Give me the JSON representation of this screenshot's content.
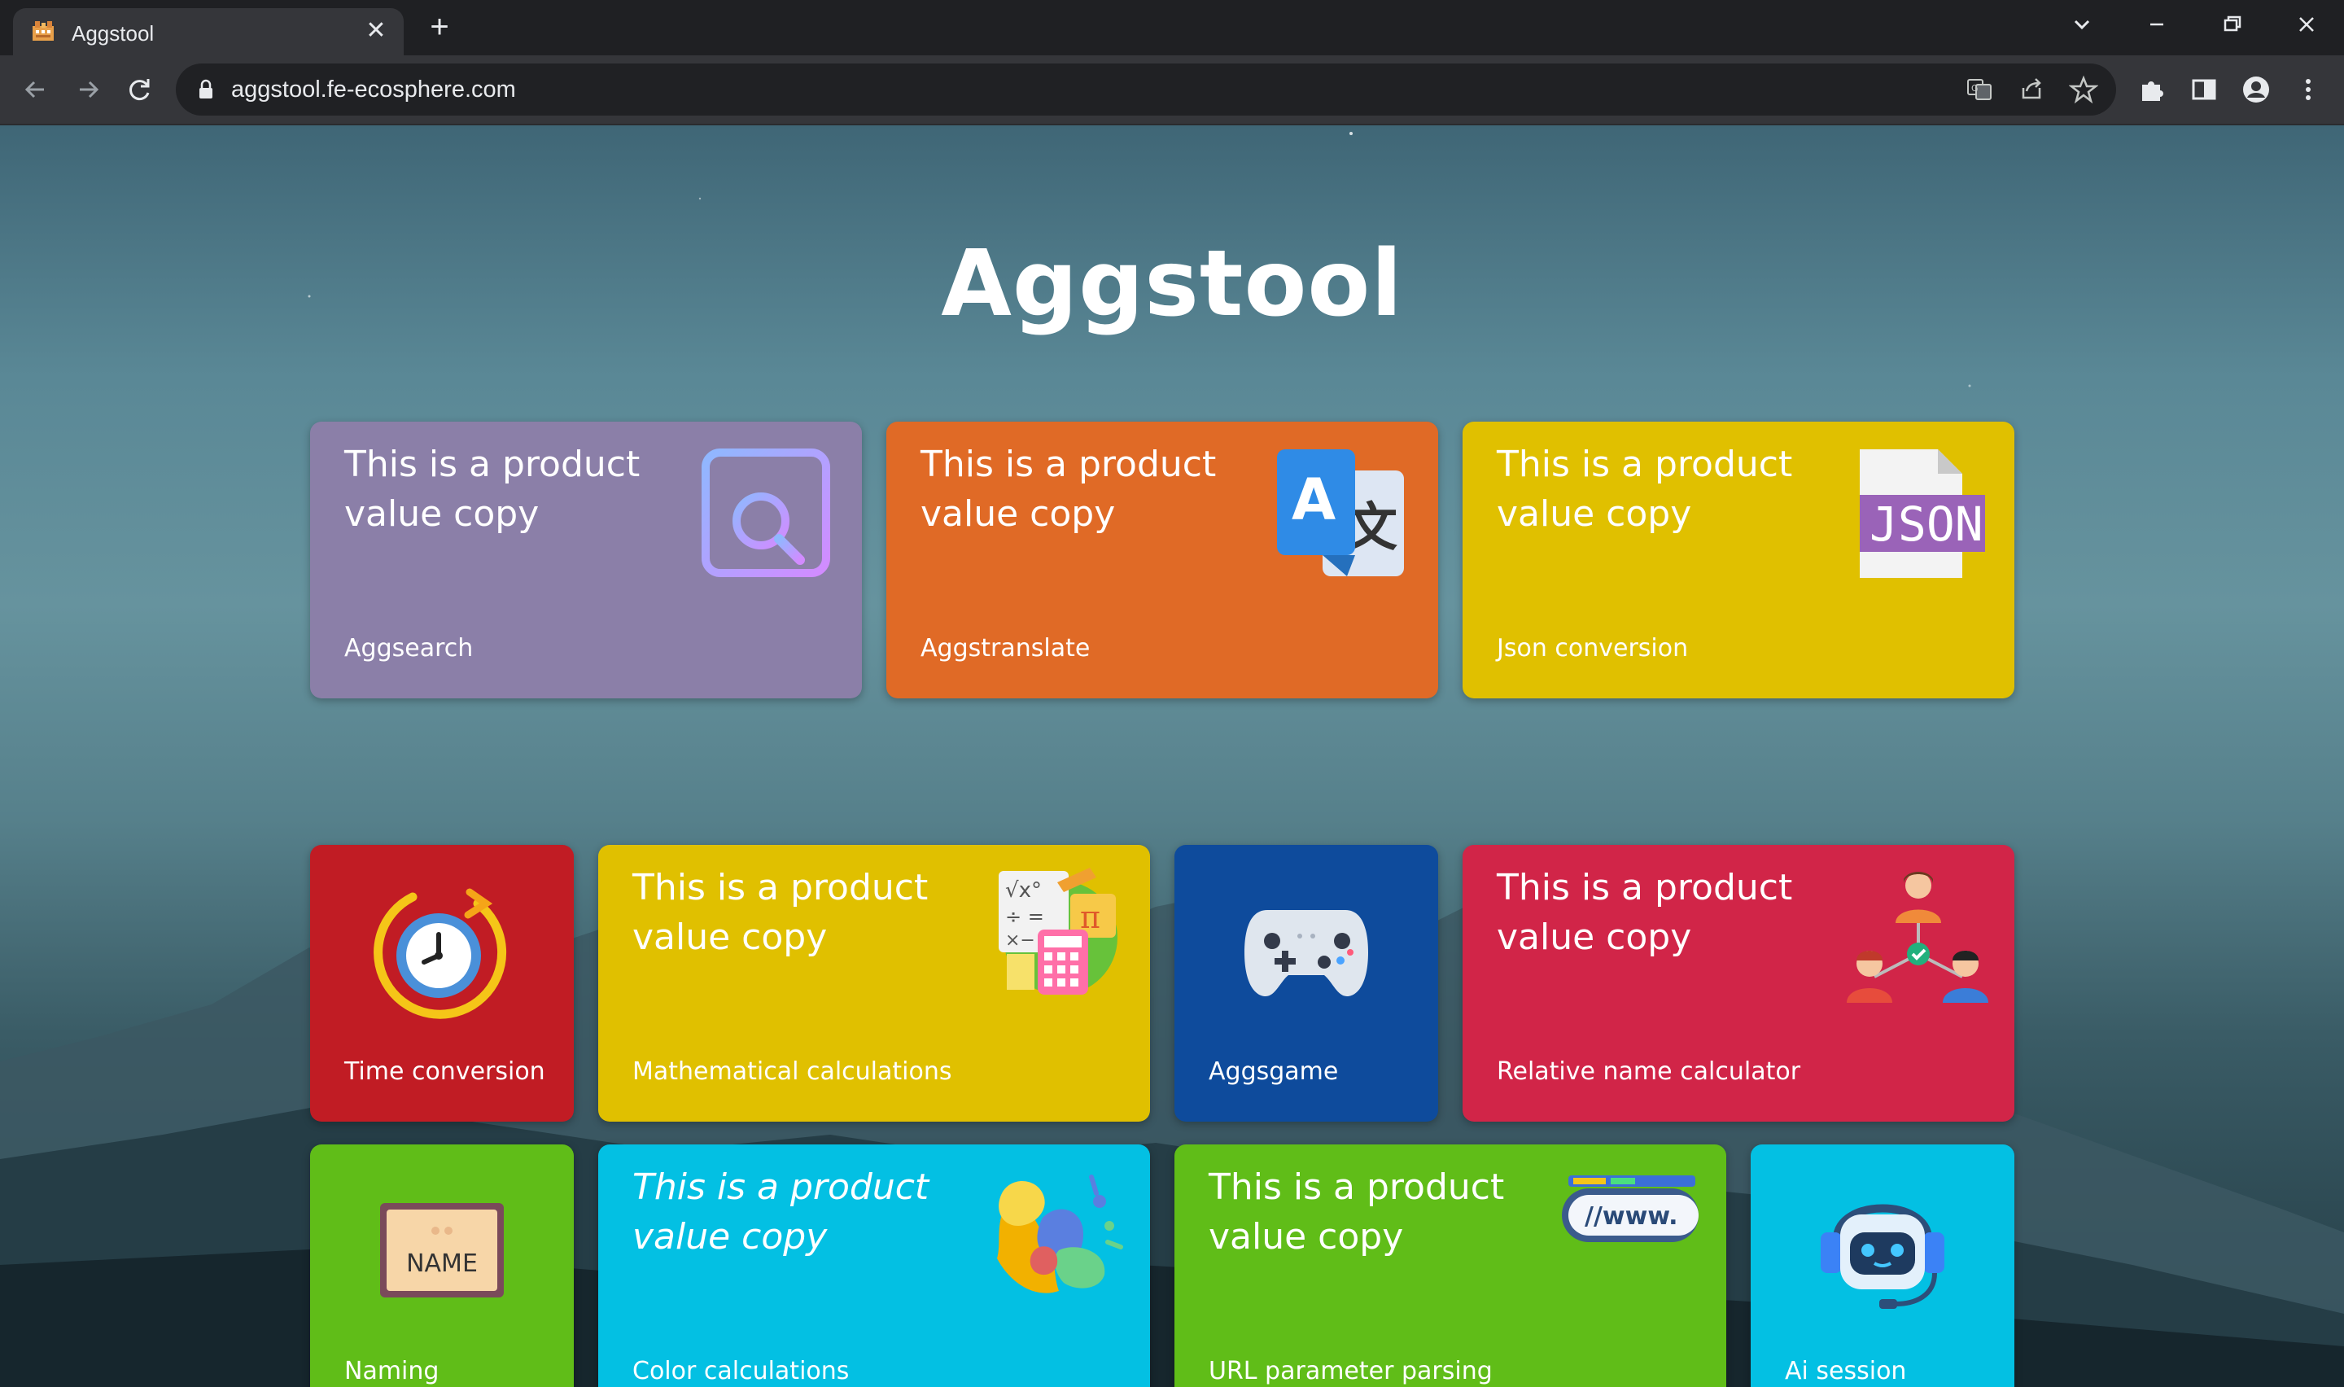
{
  "browser": {
    "tab_title": "Aggstool",
    "url": "aggstool.fe-ecosphere.com",
    "icons": [
      "app-favicon-icon",
      "close-icon",
      "plus-icon",
      "chevron-down-icon",
      "minimize-icon",
      "restore-icon",
      "close-window-icon",
      "back-icon",
      "forward-icon",
      "reload-icon",
      "lock-icon",
      "translate-icon",
      "share-icon",
      "star-icon",
      "extensions-icon",
      "side-panel-icon",
      "profile-icon",
      "menu-icon"
    ]
  },
  "page": {
    "title": "Aggstool",
    "cards": [
      {
        "copy_line1": "This is a product",
        "copy_line2": "value copy",
        "label": "Aggsearch",
        "color": "#8b7fa8",
        "icon": "search-browser-icon"
      },
      {
        "copy_line1": "This is a product",
        "copy_line2": "value copy",
        "label": "Aggstranslate",
        "color": "#e06a26",
        "icon": "translate-icon"
      },
      {
        "copy_line1": "This is a product",
        "copy_line2": "value copy",
        "label": "Json conversion",
        "color": "#e0c000",
        "icon": "json-file-icon",
        "icon_text": "JSON"
      },
      {
        "label": "Time conversion",
        "color": "#c11c24",
        "icon": "clock-icon"
      },
      {
        "copy_line1": "This is a product",
        "copy_line2": "value copy",
        "label": "Mathematical calculations",
        "color": "#e0c000",
        "icon": "math-icon"
      },
      {
        "label": "Aggsgame",
        "color": "#0e4b9c",
        "icon": "gamepad-icon"
      },
      {
        "copy_line1": "This is a product",
        "copy_line2": "value copy",
        "label": "Relative name calculator",
        "color": "#d12548",
        "icon": "relationship-icon"
      },
      {
        "label": "Naming",
        "color": "#60bd18",
        "icon": "name-tag-icon",
        "icon_text": "NAME"
      },
      {
        "copy_line1": "This is a product",
        "copy_line2": "value copy",
        "label": "Color calculations",
        "color": "#03c0e3",
        "icon": "color-splash-icon"
      },
      {
        "copy_line1": "This is a product",
        "copy_line2": "value copy",
        "label": "URL parameter parsing",
        "color": "#60bd18",
        "icon": "url-icon",
        "icon_text": "//www."
      },
      {
        "label": "Ai session",
        "color": "#03c0e3",
        "icon": "robot-icon"
      }
    ]
  }
}
